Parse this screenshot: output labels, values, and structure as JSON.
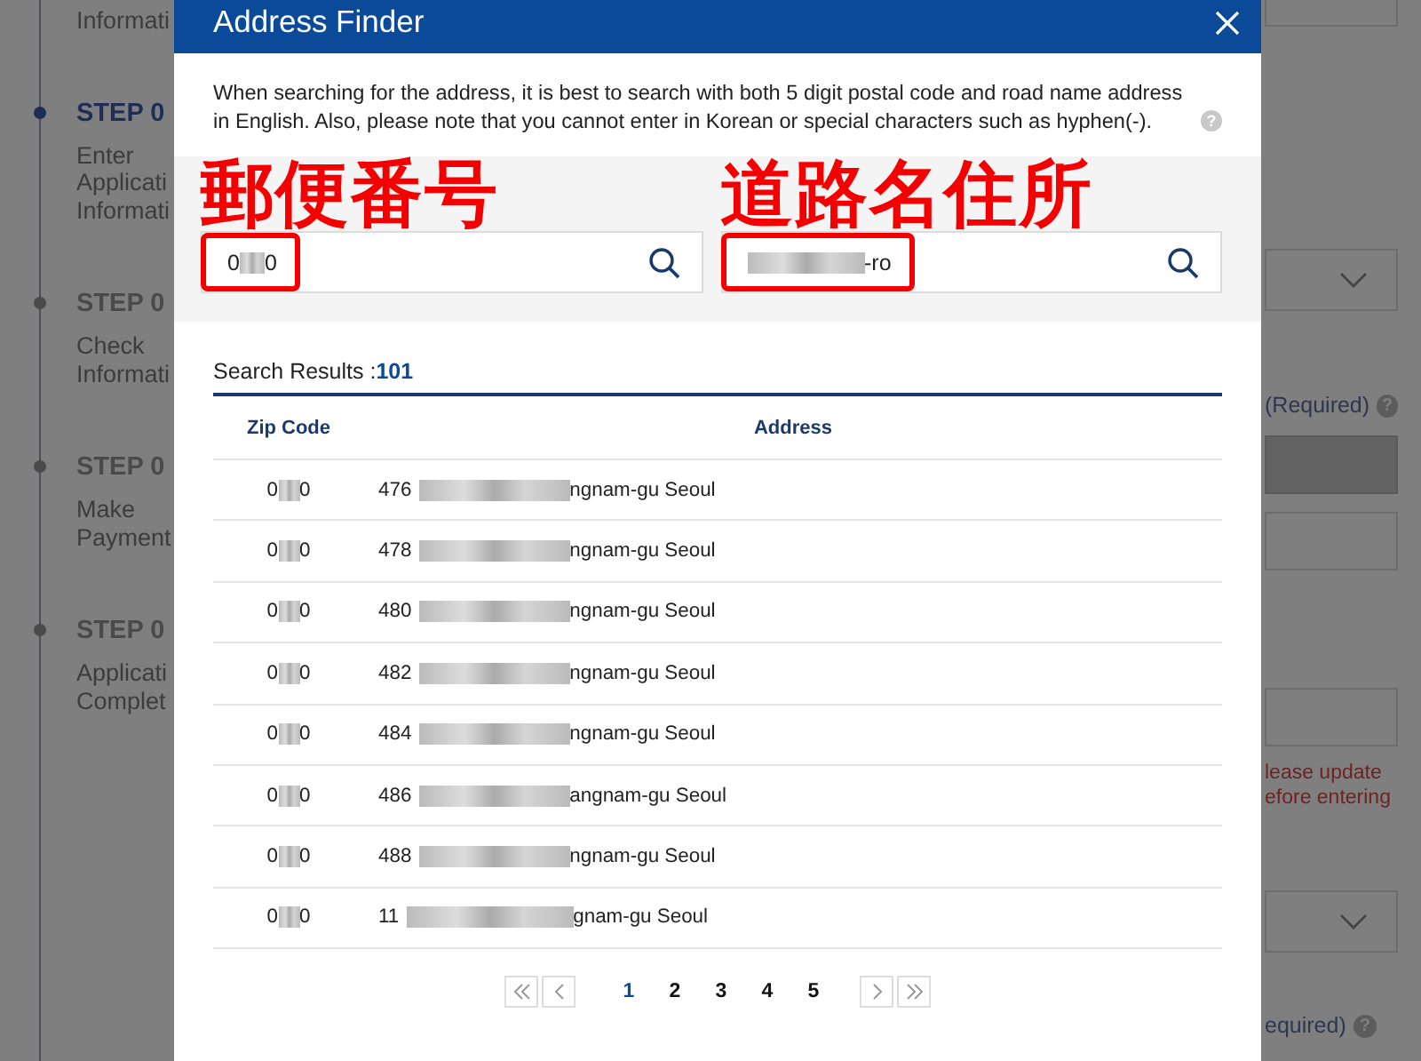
{
  "background": {
    "partial_step": {
      "lines": [
        "Informati"
      ]
    },
    "steps": [
      {
        "title": "STEP 0",
        "lines": [
          "Enter",
          "Applicati",
          "Informati"
        ],
        "current": true
      },
      {
        "title": "STEP 0",
        "lines": [
          "Check",
          "Informati"
        ],
        "current": false
      },
      {
        "title": "STEP 0",
        "lines": [
          "Make",
          "Payment"
        ],
        "current": false
      },
      {
        "title": "STEP 0",
        "lines": [
          "Applicati",
          "Complet"
        ],
        "current": false
      }
    ],
    "form_parts": [
      {
        "kind": "box",
        "disabled": false
      },
      {
        "kind": "select"
      },
      {
        "kind": "label",
        "text": "(Required)",
        "help_mark": "?"
      },
      {
        "kind": "box",
        "disabled": true
      },
      {
        "kind": "box",
        "disabled": false
      },
      {
        "kind": "box",
        "disabled": false
      },
      {
        "kind": "error",
        "lines": [
          "lease update",
          "efore entering"
        ]
      },
      {
        "kind": "select"
      },
      {
        "kind": "label",
        "text": "equired)",
        "help_mark": "?"
      }
    ]
  },
  "dialog": {
    "title": "Address Finder",
    "notice": "When searching for the address, it is best to search with both 5 digit postal code and road name address in English. Also, please note that you cannot enter in Korean or special characters such as hyphen(-).",
    "notice_help_mark": "?",
    "search_fields": [
      {
        "annotation": "郵便番号",
        "value_before": "0",
        "value_after": "0"
      },
      {
        "annotation": "道路名住所",
        "value_after": "-ro"
      }
    ],
    "results_label": "Search Results :",
    "results_count": "101",
    "columns": [
      "Zip Code",
      "Address"
    ],
    "rows": [
      {
        "zip_before": "0",
        "zip_after": "0",
        "number": "476",
        "tail": "ngnam-gu Seoul"
      },
      {
        "zip_before": "0",
        "zip_after": "0",
        "number": "478",
        "tail": "ngnam-gu Seoul"
      },
      {
        "zip_before": "0",
        "zip_after": "0",
        "number": "480",
        "tail": "ngnam-gu Seoul"
      },
      {
        "zip_before": "0",
        "zip_after": "0",
        "number": "482",
        "tail": "ngnam-gu Seoul"
      },
      {
        "zip_before": "0",
        "zip_after": "0",
        "number": "484",
        "tail": "ngnam-gu Seoul"
      },
      {
        "zip_before": "0",
        "zip_after": "0",
        "number": "486",
        "tail": "angnam-gu Seoul"
      },
      {
        "zip_before": "0",
        "zip_after": "0",
        "number": "488",
        "tail": "ngnam-gu Seoul"
      },
      {
        "zip_before": "0",
        "zip_after": "0",
        "number": "11",
        "tail": "gnam-gu Seoul"
      }
    ],
    "pagination": {
      "pages": [
        {
          "label": "1",
          "selected": true
        },
        {
          "label": "2",
          "selected": false
        },
        {
          "label": "3",
          "selected": false
        },
        {
          "label": "4",
          "selected": false
        },
        {
          "label": "5",
          "selected": false
        }
      ]
    }
  }
}
